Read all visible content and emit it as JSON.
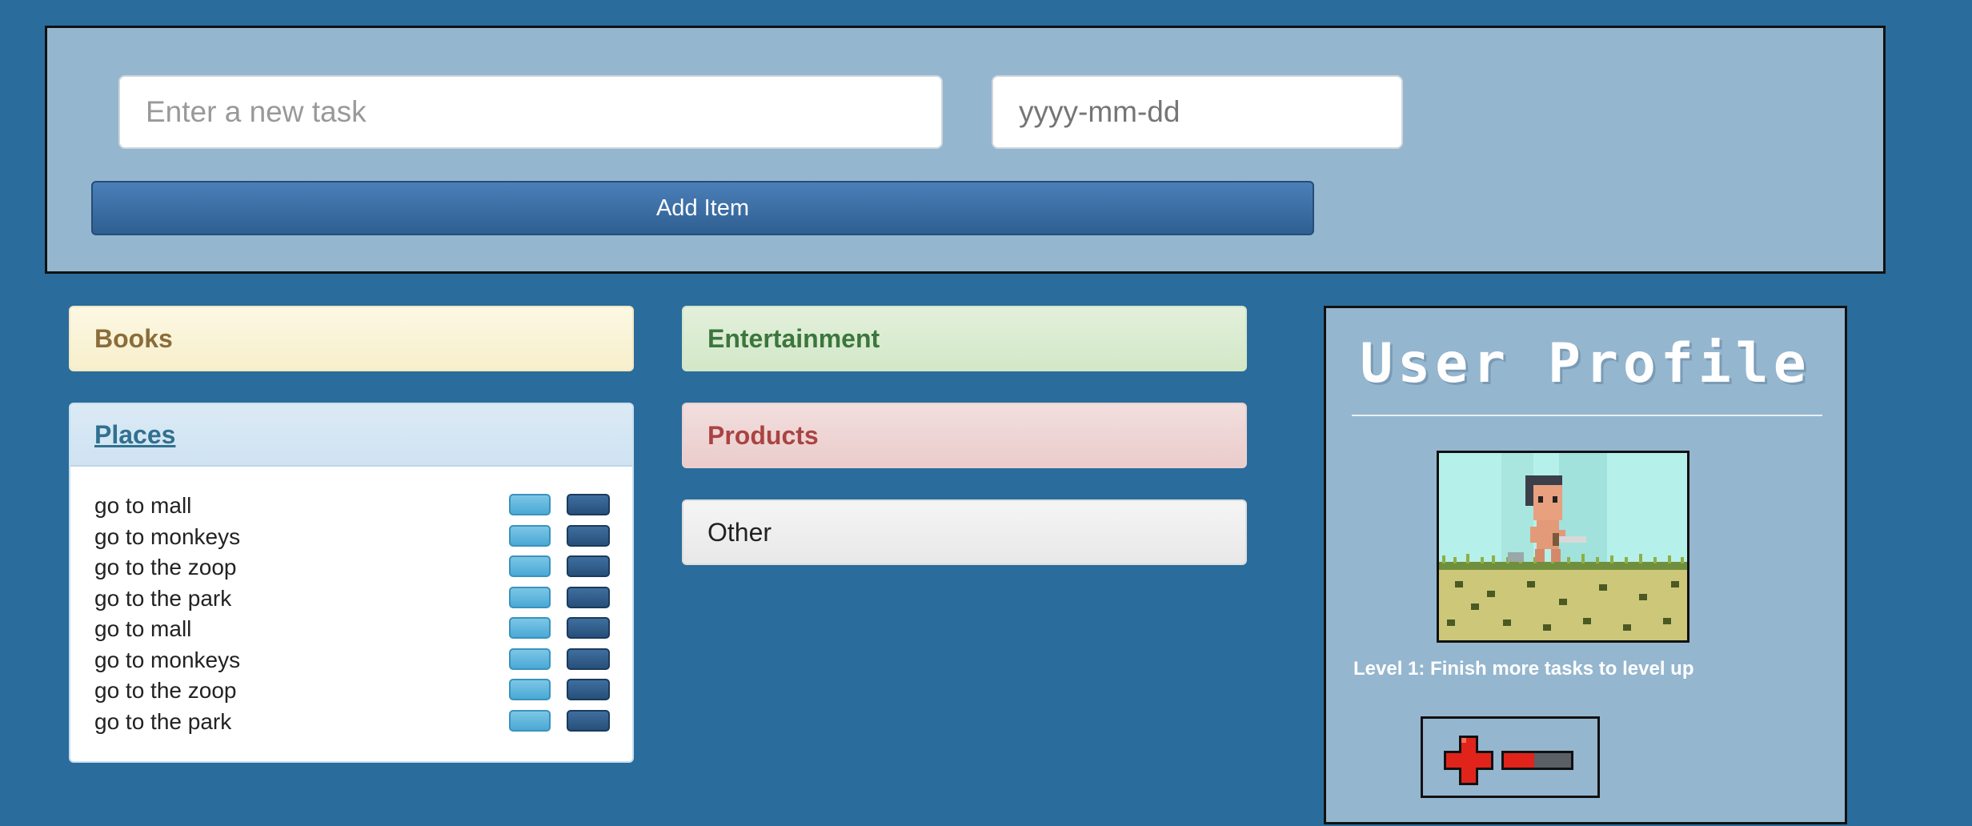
{
  "form": {
    "task_placeholder": "Enter a new task",
    "date_placeholder": "yyyy-mm-dd",
    "add_button_label": "Add Item"
  },
  "categories": {
    "books": "Books",
    "entertainment": "Entertainment",
    "places": "Places",
    "products": "Products",
    "other": "Other"
  },
  "places_items": [
    "go to mall",
    "go to monkeys",
    "go to the zoop",
    "go to the park",
    "go to mall",
    "go to monkeys",
    "go to the zoop",
    "go to the park"
  ],
  "profile": {
    "title": "User Profile",
    "level_text": "Level 1: Finish more tasks to level up",
    "health_fraction": 0.45
  },
  "colors": {
    "background": "#2a6c9c",
    "panel": "#95b6cf",
    "add_button": "#2f5f92",
    "health_red": "#e0241b"
  },
  "icons": {
    "health": "red-cross-icon",
    "avatar": "pixel-character-avatar"
  }
}
